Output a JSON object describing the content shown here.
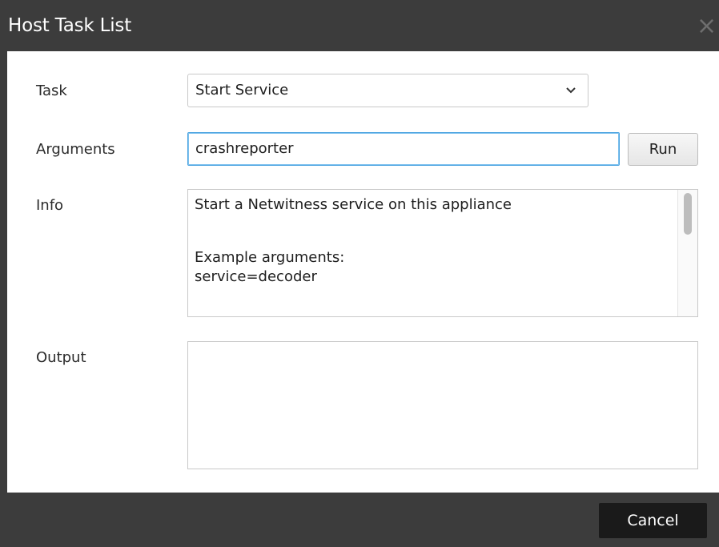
{
  "dialog": {
    "title": "Host Task List",
    "close_icon": "close-icon"
  },
  "form": {
    "task_label": "Task",
    "task_value": "Start Service",
    "arguments_label": "Arguments",
    "arguments_value": "crashreporter",
    "run_label": "Run",
    "info_label": "Info",
    "info_lines": [
      "Start a Netwitness service on this appliance",
      "",
      "Example arguments:",
      "service=decoder"
    ],
    "output_label": "Output",
    "output_value": ""
  },
  "footer": {
    "cancel_label": "Cancel"
  },
  "colors": {
    "titlebar": "#3c3c3c",
    "input_focus": "#4aa3e0",
    "cancel_button": "#1a1a1a"
  }
}
